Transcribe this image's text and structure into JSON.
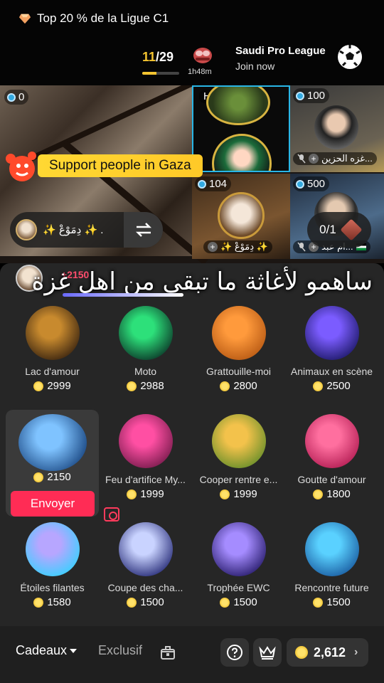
{
  "header": {
    "rank_text": "Top 20 % de la Ligue C1",
    "progress_current": "11",
    "progress_total": "/29",
    "progress_fraction": 0.38,
    "timer": "1h48m",
    "league_name": "Saudi Pro League",
    "league_action": "Join now"
  },
  "live": {
    "main_count": "0",
    "host_label": "Hôte",
    "tiles": [
      {
        "count": "100",
        "name": "غزه الحزين..."
      },
      {
        "count": "104",
        "name": "✨ دِمَوْعْ ✨"
      },
      {
        "count": "500",
        "name": "ام عبد..."
      }
    ],
    "support_text": "Support people in Gaza",
    "current_user_name": "✨ دِمَوْعْ ✨ .",
    "pager": "0/1"
  },
  "overlay": {
    "arabic_message": "ساهمو لأغاثة ما تبقى من اهل غزة",
    "gift_value": "+2150"
  },
  "gifts": [
    {
      "name": "Lac d'amour",
      "price": "2999",
      "icon": "heart-lake-icon",
      "colors": [
        "#c88a2e",
        "#3d2610"
      ]
    },
    {
      "name": "Moto",
      "price": "2988",
      "icon": "motorcycle-icon",
      "colors": [
        "#2de07a",
        "#0c3b2a"
      ]
    },
    {
      "name": "Grattouille-moi",
      "price": "2800",
      "icon": "armchair-cat-icon",
      "colors": [
        "#ff9a3c",
        "#b85a14"
      ]
    },
    {
      "name": "Animaux en scène",
      "price": "2500",
      "icon": "stage-icon",
      "colors": [
        "#7b5cff",
        "#1f1a6b"
      ]
    },
    {
      "name": "",
      "price": "2150",
      "icon": "whale-icon",
      "colors": [
        "#7fc3ff",
        "#1d4b86"
      ],
      "selected": true
    },
    {
      "name": "Feu d'artifice My...",
      "price": "1999",
      "icon": "firework-heart-icon",
      "colors": [
        "#ff4fa3",
        "#7b1c4e"
      ]
    },
    {
      "name": "Cooper rentre e...",
      "price": "1999",
      "icon": "corgi-balloons-icon",
      "colors": [
        "#f3c24b",
        "#6a8f2a"
      ]
    },
    {
      "name": "Goutte d'amour",
      "price": "1800",
      "icon": "pink-drop-icon",
      "colors": [
        "#ff6f9f",
        "#b51f55"
      ]
    },
    {
      "name": "Étoiles filantes",
      "price": "1580",
      "icon": "shooting-star-icon",
      "colors": [
        "#b7a6ff",
        "#3ad0ff"
      ]
    },
    {
      "name": "Coupe des cha...",
      "price": "1500",
      "icon": "trophy-cup-icon",
      "colors": [
        "#c9d3ff",
        "#2a2f7a"
      ]
    },
    {
      "name": "Trophée EWC",
      "price": "1500",
      "icon": "ewc-trophy-icon",
      "colors": [
        "#a58cff",
        "#2a1e6e"
      ]
    },
    {
      "name": "Rencontre future",
      "price": "1500",
      "icon": "blue-heart-box-icon",
      "colors": [
        "#5ad1ff",
        "#1b5fa3"
      ]
    }
  ],
  "send_label": "Envoyer",
  "bottom": {
    "tab_gifts": "Cadeaux",
    "tab_exclusive": "Exclusif",
    "balance": "2,612"
  }
}
